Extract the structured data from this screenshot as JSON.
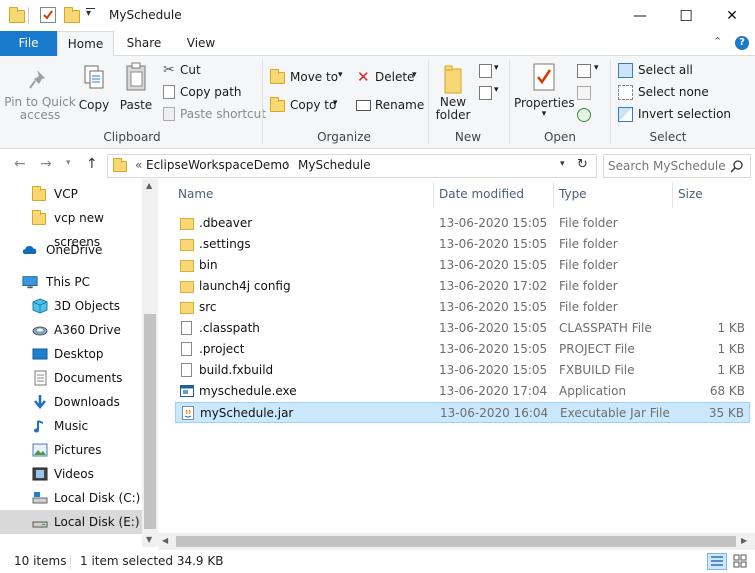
{
  "window": {
    "title": "MySchedule",
    "minimize": "—",
    "maximize": "☐",
    "close": "✕"
  },
  "tabs": [
    {
      "label": "File"
    },
    {
      "label": "Home"
    },
    {
      "label": "Share"
    },
    {
      "label": "View"
    }
  ],
  "ribbon": {
    "clipboard": {
      "label": "Clipboard",
      "pin": "Pin to Quick access",
      "pin_line1": "Pin to Quick",
      "pin_line2": "access",
      "copy": "Copy",
      "paste": "Paste",
      "cut": "Cut",
      "copy_path": "Copy path",
      "paste_shortcut": "Paste shortcut"
    },
    "organize": {
      "label": "Organize",
      "move_to": "Move to",
      "copy_to": "Copy to",
      "delete": "Delete",
      "rename": "Rename"
    },
    "new": {
      "label": "New",
      "new_folder_line1": "New",
      "new_folder_line2": "folder"
    },
    "open": {
      "label": "Open",
      "properties": "Properties"
    },
    "select": {
      "label": "Select",
      "select_all": "Select all",
      "select_none": "Select none",
      "invert": "Invert selection"
    }
  },
  "address": {
    "prefix": "«",
    "crumbs": [
      "EclipseWorkspaceDemo",
      "MySchedule"
    ],
    "search_placeholder": "Search MySchedule"
  },
  "nav": [
    {
      "label": "VCP",
      "icon": "folder-icon"
    },
    {
      "label": "vcp new screens",
      "icon": "folder-icon"
    },
    {
      "label": "OneDrive",
      "icon": "onedrive-icon"
    },
    {
      "label": "This PC",
      "icon": "pc-icon"
    },
    {
      "label": "3D Objects",
      "icon": "cube-icon"
    },
    {
      "label": "A360 Drive",
      "icon": "drive-icon"
    },
    {
      "label": "Desktop",
      "icon": "desktop-icon"
    },
    {
      "label": "Documents",
      "icon": "documents-icon"
    },
    {
      "label": "Downloads",
      "icon": "download-icon"
    },
    {
      "label": "Music",
      "icon": "music-icon"
    },
    {
      "label": "Pictures",
      "icon": "pictures-icon"
    },
    {
      "label": "Videos",
      "icon": "videos-icon"
    },
    {
      "label": "Local Disk (C:)",
      "icon": "disk-c-icon"
    },
    {
      "label": "Local Disk (E:)",
      "icon": "disk-icon"
    }
  ],
  "columns": {
    "name": "Name",
    "date": "Date modified",
    "type": "Type",
    "size": "Size"
  },
  "files": [
    {
      "name": ".dbeaver",
      "date": "13-06-2020 15:05",
      "type": "File folder",
      "size": "",
      "kind": "folder"
    },
    {
      "name": ".settings",
      "date": "13-06-2020 15:05",
      "type": "File folder",
      "size": "",
      "kind": "folder"
    },
    {
      "name": "bin",
      "date": "13-06-2020 15:05",
      "type": "File folder",
      "size": "",
      "kind": "folder"
    },
    {
      "name": "launch4j config",
      "date": "13-06-2020 17:02",
      "type": "File folder",
      "size": "",
      "kind": "folder"
    },
    {
      "name": "src",
      "date": "13-06-2020 15:05",
      "type": "File folder",
      "size": "",
      "kind": "folder"
    },
    {
      "name": ".classpath",
      "date": "13-06-2020 15:05",
      "type": "CLASSPATH File",
      "size": "1 KB",
      "kind": "doc"
    },
    {
      "name": ".project",
      "date": "13-06-2020 15:05",
      "type": "PROJECT File",
      "size": "1 KB",
      "kind": "doc"
    },
    {
      "name": "build.fxbuild",
      "date": "13-06-2020 15:05",
      "type": "FXBUILD File",
      "size": "1 KB",
      "kind": "doc"
    },
    {
      "name": "myschedule.exe",
      "date": "13-06-2020 17:04",
      "type": "Application",
      "size": "68 KB",
      "kind": "exe"
    },
    {
      "name": "mySchedule.jar",
      "date": "13-06-2020 16:04",
      "type": "Executable Jar File",
      "size": "35 KB",
      "kind": "jar"
    }
  ],
  "status": {
    "count": "10 items",
    "selection": "1 item selected  34.9 KB"
  },
  "colors": {
    "accent": "#1979ca",
    "selection": "#cce8ff",
    "folder": "#f8d775"
  }
}
